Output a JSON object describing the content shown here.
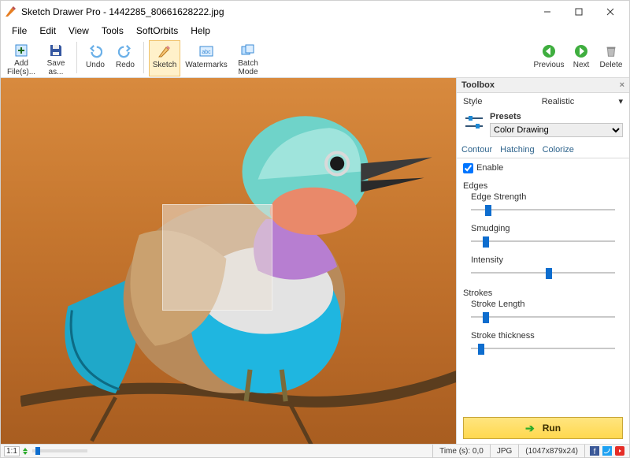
{
  "window": {
    "title": "Sketch Drawer Pro - 1442285_80661628222.jpg",
    "controls": {
      "min": "–",
      "max": "☐",
      "close": "✕"
    }
  },
  "menu": [
    "File",
    "Edit",
    "View",
    "Tools",
    "SoftOrbits",
    "Help"
  ],
  "toolbar": {
    "add": {
      "label": "Add File(s)..."
    },
    "save": {
      "label": "Save as..."
    },
    "undo": {
      "label": "Undo"
    },
    "redo": {
      "label": "Redo"
    },
    "sketch": {
      "label": "Sketch"
    },
    "watermarks": {
      "label": "Watermarks"
    },
    "batch": {
      "label": "Batch Mode"
    },
    "previous": {
      "label": "Previous"
    },
    "next": {
      "label": "Next"
    },
    "delete": {
      "label": "Delete"
    }
  },
  "toolbox": {
    "title": "Toolbox",
    "style": {
      "label": "Style",
      "value": "Realistic"
    },
    "presets": {
      "label": "Presets",
      "value": "Color Drawing"
    },
    "tabs": [
      "Contour",
      "Hatching",
      "Colorize"
    ],
    "enable": {
      "label": "Enable",
      "checked": true
    },
    "edges": {
      "title": "Edges",
      "edge_strength": {
        "label": "Edge Strength",
        "pct": 10
      },
      "smudging": {
        "label": "Smudging",
        "pct": 8
      },
      "intensity": {
        "label": "Intensity",
        "pct": 52
      }
    },
    "strokes": {
      "title": "Strokes",
      "stroke_length": {
        "label": "Stroke Length",
        "pct": 8
      },
      "stroke_thickness": {
        "label": "Stroke thickness",
        "pct": 5
      }
    },
    "run": {
      "label": "Run"
    }
  },
  "status": {
    "zoom": "1:1",
    "time": "Time (s): 0,0",
    "format": "JPG",
    "dims": "(1047x879x24)"
  }
}
